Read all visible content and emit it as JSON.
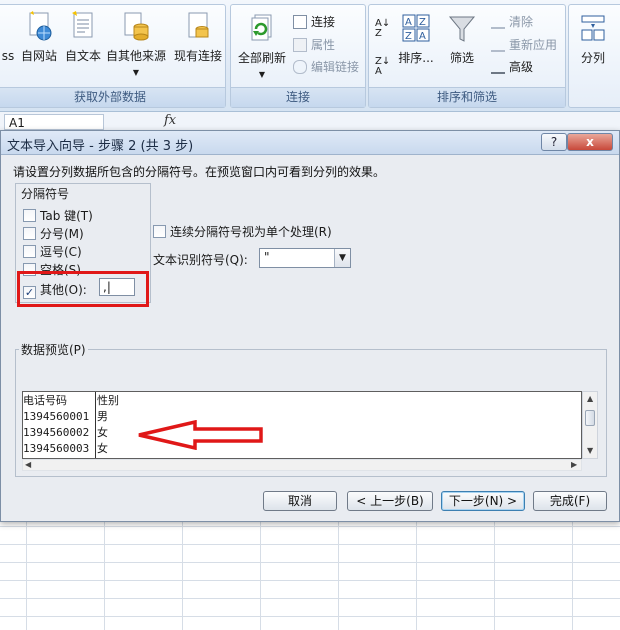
{
  "ribbon": {
    "groups": [
      {
        "title": "获取外部数据",
        "buttons": [
          "ss",
          "自网站",
          "自文本",
          "自其他来源",
          "现有连接"
        ]
      },
      {
        "title": "连接",
        "buttons": [
          "全部刷新"
        ],
        "small": [
          "连接",
          "属性",
          "编辑链接"
        ]
      },
      {
        "title": "排序和筛选",
        "buttons": [
          "排序...",
          "筛选"
        ],
        "small": [
          "清除",
          "重新应用",
          "高级"
        ]
      },
      {
        "title": "",
        "buttons": [
          "分列"
        ]
      }
    ]
  },
  "formula_bar": {
    "cell_ref": "A1",
    "fx": "fx"
  },
  "dialog": {
    "title": "文本导入向导 - 步骤 2 (共 3 步)",
    "help": "?",
    "close": "x",
    "instruction": "请设置分列数据所包含的分隔符号。在预览窗口内可看到分列的效果。",
    "delimiter_group": "分隔符号",
    "delimiters": [
      {
        "label": "Tab 键(T)",
        "checked": false
      },
      {
        "label": "分号(M)",
        "checked": false
      },
      {
        "label": "逗号(C)",
        "checked": false
      },
      {
        "label": "空格(S)",
        "checked": false
      },
      {
        "label": "其他(O):",
        "checked": true
      }
    ],
    "other_value": ",|",
    "consecutive_label": "连续分隔符号视为单个处理(R)",
    "consecutive_checked": false,
    "text_qualifier_label": "文本识别符号(Q):",
    "text_qualifier_value": "\"",
    "preview_label": "数据预览(P)",
    "preview_rows": [
      [
        "电话号码",
        "性别"
      ],
      [
        "1394560001",
        "男"
      ],
      [
        "1394560002",
        "女"
      ],
      [
        "1394560003",
        "女"
      ]
    ],
    "buttons": {
      "cancel": "取消",
      "back": "< 上一步(B)",
      "next": "下一步(N) >",
      "finish": "完成(F)"
    }
  },
  "colors": {
    "highlight": "#e01818",
    "accent": "#3c7fb1"
  }
}
